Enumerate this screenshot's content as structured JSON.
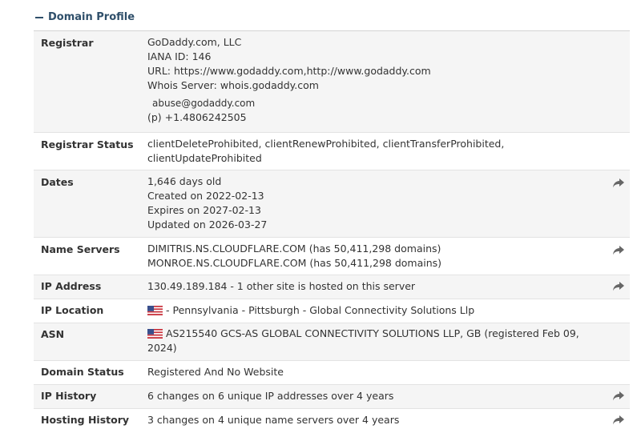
{
  "section": {
    "title": "Domain Profile"
  },
  "registrar": {
    "label": "Registrar",
    "name": "GoDaddy.com, LLC",
    "iana": "IANA ID: 146",
    "url": "URL: https://www.godaddy.com,http://www.godaddy.com",
    "whois": "Whois Server: whois.godaddy.com",
    "email": "abuse@godaddy.com",
    "phone": "(p)  +1.4806242505"
  },
  "registrar_status": {
    "label": "Registrar Status",
    "line1": "clientDeleteProhibited, clientRenewProhibited, clientTransferProhibited,",
    "line2": "clientUpdateProhibited"
  },
  "dates": {
    "label": "Dates",
    "age": "1,646 days old",
    "created": "Created on 2022-02-13",
    "expires": "Expires on 2027-02-13",
    "updated": "Updated on 2026-03-27"
  },
  "name_servers": {
    "label": "Name Servers",
    "ns1": "DIMITRIS.NS.CLOUDFLARE.COM (has 50,411,298 domains)",
    "ns2": "MONROE.NS.CLOUDFLARE.COM (has 50,411,298 domains)"
  },
  "ip_address": {
    "label": "IP Address",
    "value": "130.49.189.184 - 1 other site is hosted on this server"
  },
  "ip_location": {
    "label": "IP Location",
    "value": "- Pennsylvania - Pittsburgh - Global Connectivity Solutions Llp"
  },
  "asn": {
    "label": "ASN",
    "line1": "AS215540 GCS-AS GLOBAL CONNECTIVITY SOLUTIONS LLP, GB (registered Feb 09,",
    "line2": "2024)"
  },
  "domain_status": {
    "label": "Domain Status",
    "value": "Registered And No Website"
  },
  "ip_history": {
    "label": "IP History",
    "value": "6 changes on 6 unique IP addresses over 4 years"
  },
  "hosting_history": {
    "label": "Hosting History",
    "value": "3 changes on 4 unique name servers over 4 years"
  },
  "icons": {
    "share": "share-arrow-icon",
    "flag": "us-flag-icon",
    "collapse": "minus-icon"
  },
  "colors": {
    "header": "#2f4f6a",
    "alt_row": "#f5f5f5",
    "border": "#e3e3e3",
    "text": "#333333"
  }
}
